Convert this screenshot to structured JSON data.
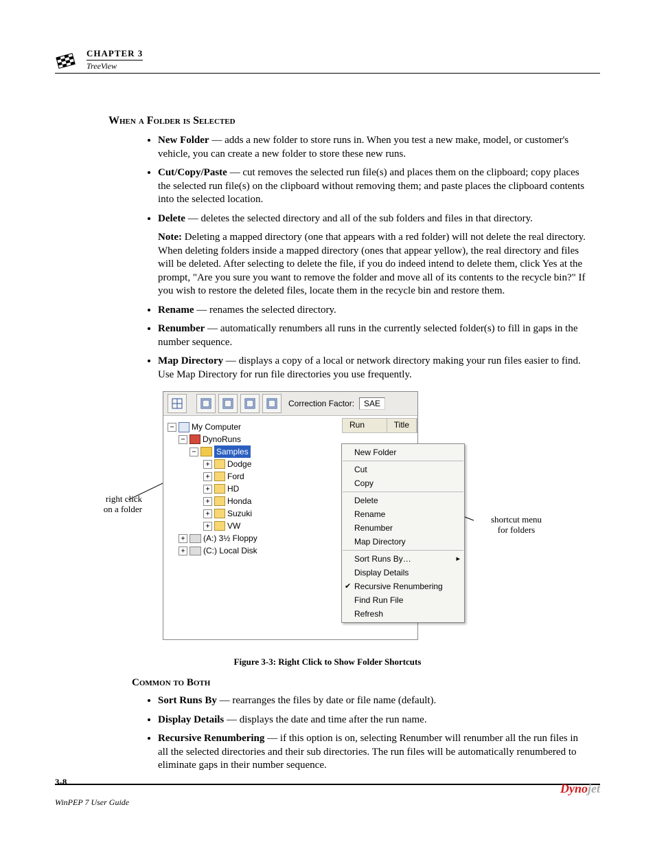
{
  "header": {
    "chapter": "CHAPTER 3",
    "subtitle": "TreeView"
  },
  "section1": {
    "title": "When a Folder is Selected",
    "items": [
      {
        "term": "New Folder",
        "text": " — adds a new folder to store runs in. When you test a new make, model, or customer's vehicle, you can create a new folder to store these new runs."
      },
      {
        "term": "Cut/Copy/Paste",
        "text": " — cut removes the selected run file(s) and places them on the clipboard; copy places the selected run file(s) on the clipboard without removing them; and paste places the clipboard contents into the selected location."
      },
      {
        "term": "Delete",
        "text": " — deletes the selected directory and all of the sub folders and files in that directory."
      },
      {
        "term": "Rename",
        "text": " — renames the selected directory."
      },
      {
        "term": "Renumber",
        "text": " — automatically renumbers all runs in the currently selected folder(s) to fill in gaps in the number sequence."
      },
      {
        "term": "Map Directory",
        "text": " — displays a copy of a local or network directory making your run files easier to find. Use Map Directory for run file directories you use frequently."
      }
    ],
    "note_label": "Note:",
    "note_text": " Deleting a mapped directory (one that appears with a red folder) will not delete the real directory. When deleting folders inside a mapped directory (ones that appear yellow), the real directory and files will be deleted. After selecting to delete the file, if you do indeed intend to delete them, click Yes at the prompt, \"Are you sure you want to remove the folder and move all of its contents to the recycle bin?\" If you wish to restore the deleted files, locate them in the recycle bin and restore them."
  },
  "figure": {
    "caption": "Figure 3-3: Right Click to Show Folder Shortcuts",
    "callout_left_l1": "right click",
    "callout_left_l2": "on a folder",
    "callout_right_l1": "shortcut menu",
    "callout_right_l2": "for folders",
    "toolbar": {
      "cf_label": "Correction Factor:",
      "cf_value": "SAE"
    },
    "list_headers": {
      "run": "Run",
      "title": "Title"
    },
    "tree": {
      "my_computer": "My Computer",
      "dynoruns": "DynoRuns",
      "samples": "Samples",
      "dodge": "Dodge",
      "ford": "Ford",
      "hd": "HD",
      "honda": "Honda",
      "suzuki": "Suzuki",
      "vw": "VW",
      "floppy": "(A:)  3½ Floppy",
      "local": "(C:)  Local Disk"
    },
    "menu": {
      "new_folder": "New Folder",
      "cut": "Cut",
      "copy": "Copy",
      "delete": "Delete",
      "rename": "Rename",
      "renumber": "Renumber",
      "map_directory": "Map Directory",
      "sort_runs_by": "Sort Runs By…",
      "display_details": "Display Details",
      "recursive": "Recursive Renumbering",
      "find_run": "Find Run File",
      "refresh": "Refresh"
    }
  },
  "section2": {
    "title": "Common to Both",
    "items": [
      {
        "term": "Sort Runs By",
        "text": " — rearranges the files by date or file name (default)."
      },
      {
        "term": "Display Details",
        "text": " — displays the date and time after the run name."
      },
      {
        "term": "Recursive Renumbering",
        "text": " — if this option is on, selecting Renumber will renumber all the run files in all the selected directories and their sub directories. The run files will be automatically renumbered to eliminate gaps in their number sequence."
      }
    ]
  },
  "footer": {
    "page": "3-8",
    "guide": "WinPEP 7 User Guide",
    "logo_red": "Dyno",
    "logo_gray": "jet"
  }
}
